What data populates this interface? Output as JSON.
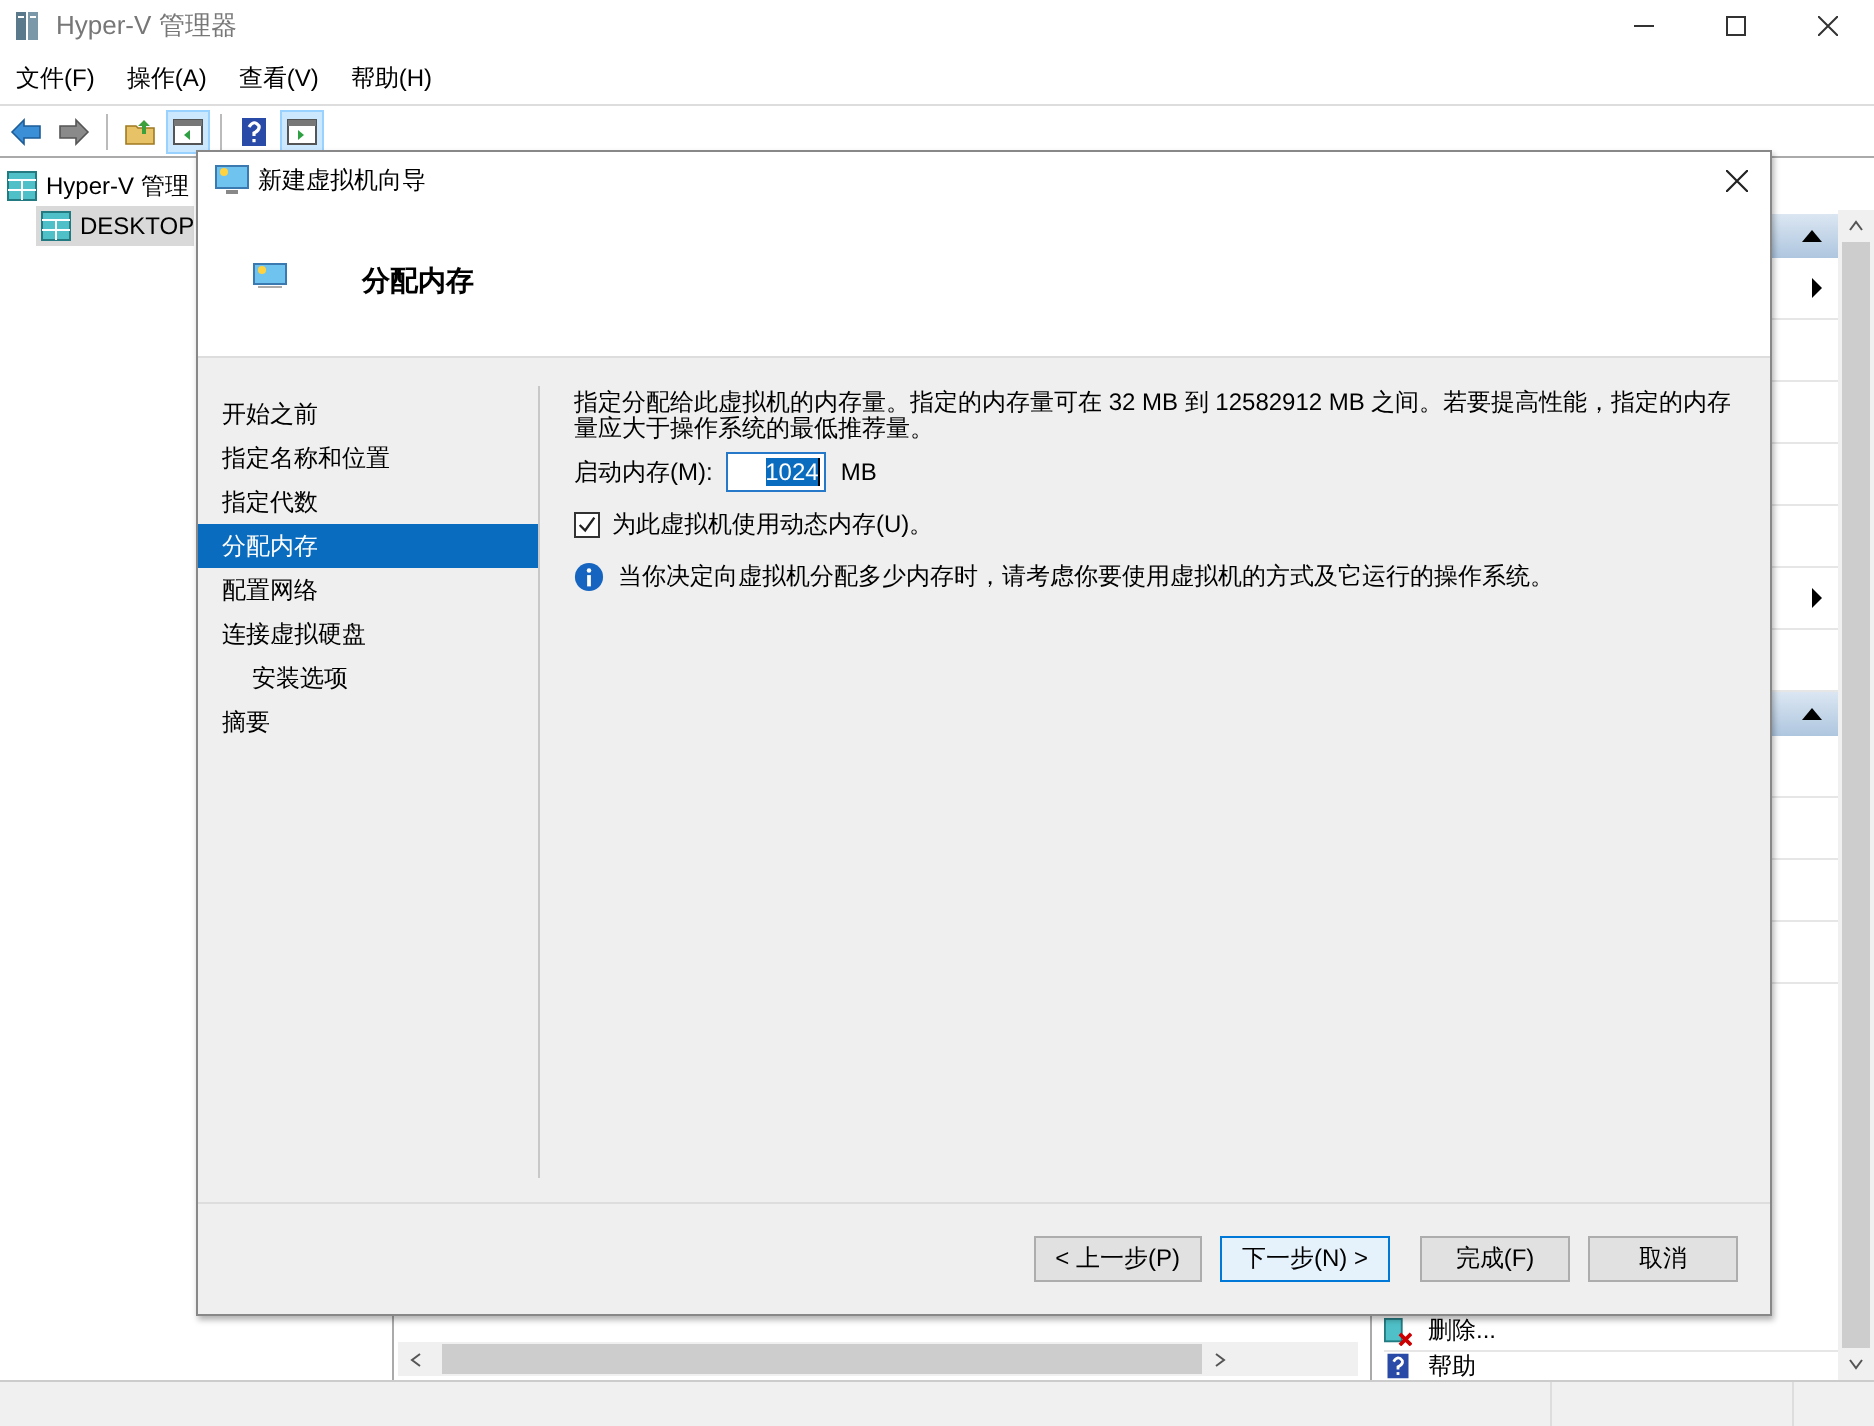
{
  "window": {
    "title": "Hyper-V 管理器"
  },
  "menu": [
    "文件(F)",
    "操作(A)",
    "查看(V)",
    "帮助(H)"
  ],
  "toolbar": [
    {
      "kind": "back",
      "on": false
    },
    {
      "kind": "forward",
      "on": false
    },
    {
      "kind": "up",
      "on": false
    },
    {
      "kind": "tree",
      "on": true
    },
    {
      "kind": "help",
      "on": false
    },
    {
      "kind": "actions",
      "on": true
    }
  ],
  "tree": [
    {
      "label": "Hyper-V 管理",
      "selected": false,
      "children": [
        {
          "label": "DESKTOP",
          "selected": true
        }
      ]
    }
  ],
  "actions": [
    "删除...",
    "帮助"
  ],
  "dialog": {
    "title": "新建虚拟机向导",
    "heading": "分配内存",
    "steps": [
      {
        "label": "开始之前",
        "selected": false
      },
      {
        "label": "指定名称和位置",
        "selected": false
      },
      {
        "label": "指定代数",
        "selected": false
      },
      {
        "label": "分配内存",
        "selected": true
      },
      {
        "label": "配置网络",
        "selected": false
      },
      {
        "label": "连接虚拟硬盘",
        "selected": false,
        "children": [
          {
            "label": "安装选项",
            "selected": false
          }
        ]
      },
      {
        "label": "摘要",
        "selected": false
      }
    ],
    "description": "指定分配给此虚拟机的内存量。指定的内存量可在 32 MB 到 12582912 MB 之间。若要提高性能，指定的内存量应大于操作系统的最低推荐量。",
    "startup_memory": {
      "label": "启动内存(M):",
      "value": "1024",
      "unit": "MB"
    },
    "dynamic_memory": {
      "label": "为此虚拟机使用动态内存(U)。",
      "checked": true
    },
    "info": "当你决定向虚拟机分配多少内存时，请考虑你要使用虚拟机的方式及它运行的操作系统。",
    "buttons": [
      {
        "label": "< 上一步(P)",
        "default": false
      },
      {
        "label": "下一步(N) >",
        "default": true
      },
      {
        "label": "完成(F)",
        "default": false
      },
      {
        "label": "取消",
        "default": false
      }
    ]
  }
}
